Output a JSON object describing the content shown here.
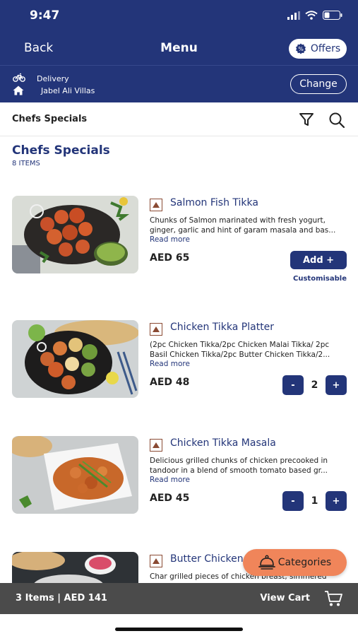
{
  "status_bar": {
    "time": "9:47"
  },
  "nav": {
    "back_label": "Back",
    "title": "Menu",
    "offers_label": "Offers"
  },
  "delivery": {
    "mode": "Delivery",
    "location": "Jabel Ali Villas",
    "change_label": "Change"
  },
  "category_bar": {
    "label": "Chefs Specials"
  },
  "section": {
    "title": "Chefs Specials",
    "count": "8 ITEMS"
  },
  "items": [
    {
      "name": "Salmon Fish Tikka",
      "description": "Chunks of Salmon marinated with fresh yogurt, ginger, garlic and hint of garam masala and bas...",
      "read_more": "Read more",
      "price": "AED 65",
      "action": "add",
      "add_label": "Add +",
      "customisable_label": "Customisable"
    },
    {
      "name": "Chicken Tikka Platter",
      "description": "(2pc Chicken Tikka/2pc Chicken Malai Tikka/ 2pc Basil Chicken Tikka/2pc Butter Chicken Tikka/2...",
      "read_more": "Read more",
      "price": "AED 48",
      "action": "stepper",
      "quantity": "2",
      "minus_label": "-",
      "plus_label": "+"
    },
    {
      "name": "Chicken Tikka Masala",
      "description": "Delicious grilled chunks of chicken precooked in tandoor in a blend of smooth tomato based gr...",
      "read_more": "Read more",
      "price": "AED 45",
      "action": "stepper",
      "quantity": "1",
      "minus_label": "-",
      "plus_label": "+"
    },
    {
      "name": "Butter Chicken",
      "description": "Char grilled pieces of chicken breast, simmered",
      "read_more": "",
      "price": "",
      "action": "none"
    }
  ],
  "categories_button": {
    "label": "Categories"
  },
  "cart": {
    "summary": "3 Items | AED 141",
    "view_label": "View Cart"
  },
  "colors": {
    "primary": "#233579",
    "accent": "#f0855a",
    "cart_bar": "#4b4b4b"
  }
}
